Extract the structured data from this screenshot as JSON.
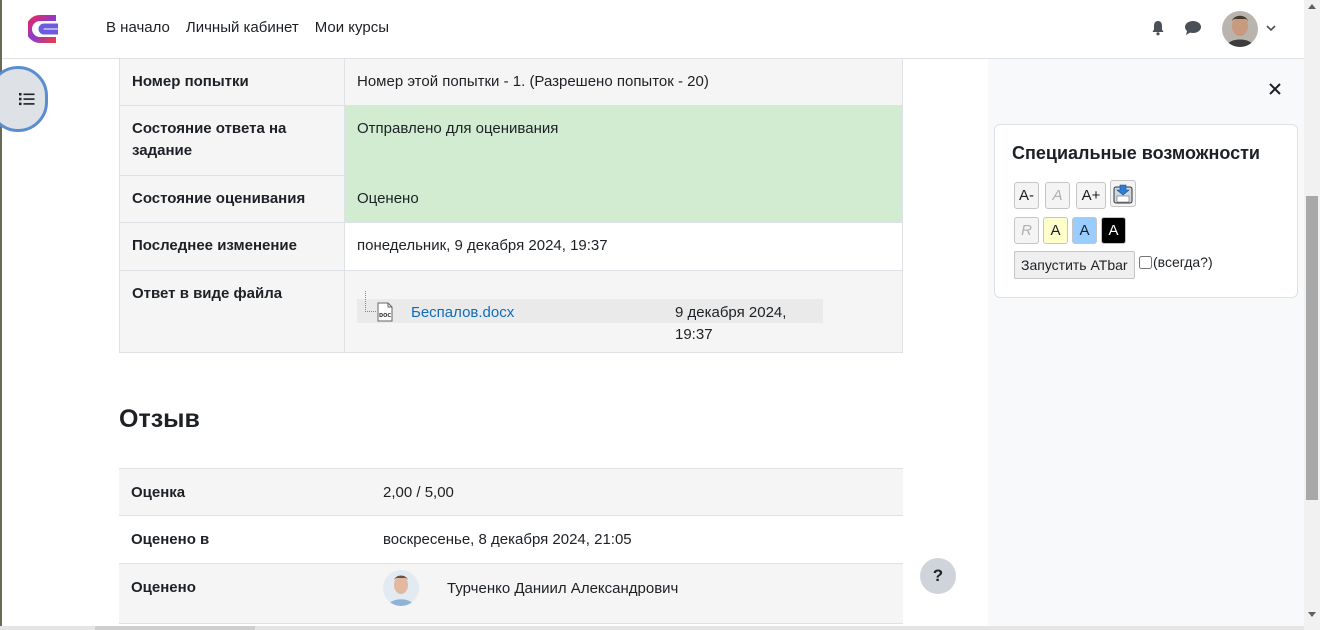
{
  "nav": {
    "logo_icon": "brand-logo-icon",
    "links": [
      "В начало",
      "Личный кабинет",
      "Мои курсы"
    ],
    "notifications_icon": "bell-icon",
    "messages_icon": "chat-icon",
    "user_menu_icon": "chevron-down-icon"
  },
  "submission": {
    "rows": [
      {
        "label": "Номер попытки",
        "value": "Номер этой попытки - 1. (Разрешено попыток - 20)"
      },
      {
        "label": "Состояние ответа на задание",
        "value": "Отправлено для оценивания"
      },
      {
        "label": "Состояние оценивания",
        "value": "Оценено"
      },
      {
        "label": "Последнее изменение",
        "value": "понедельник, 9 декабря 2024, 19:37"
      },
      {
        "label": "Ответ в виде файла",
        "file_name": "Беспалов.docx",
        "file_date": "9 декабря 2024, 19:37"
      }
    ]
  },
  "feedback": {
    "title": "Отзыв",
    "rows": [
      {
        "label": "Оценка",
        "value": "2,00 / 5,00"
      },
      {
        "label": "Оценено в",
        "value": "воскресенье, 8 декабря 2024, 21:05"
      },
      {
        "label": "Оценено",
        "value": "Турченко Даниил Александрович"
      }
    ]
  },
  "accessibility": {
    "title": "Специальные возможности",
    "font_buttons": [
      "A-",
      "A",
      "A+"
    ],
    "color_buttons": [
      "R",
      "A",
      "A",
      "A"
    ],
    "atbar_button": "Запустить ATbar",
    "always_label": "(всегда?)"
  },
  "help": {
    "label": "?"
  },
  "colors": {
    "accent": "#0f6cbf",
    "success_bg": "#d1ecd1",
    "toggle_border": "#5b8ed1"
  }
}
